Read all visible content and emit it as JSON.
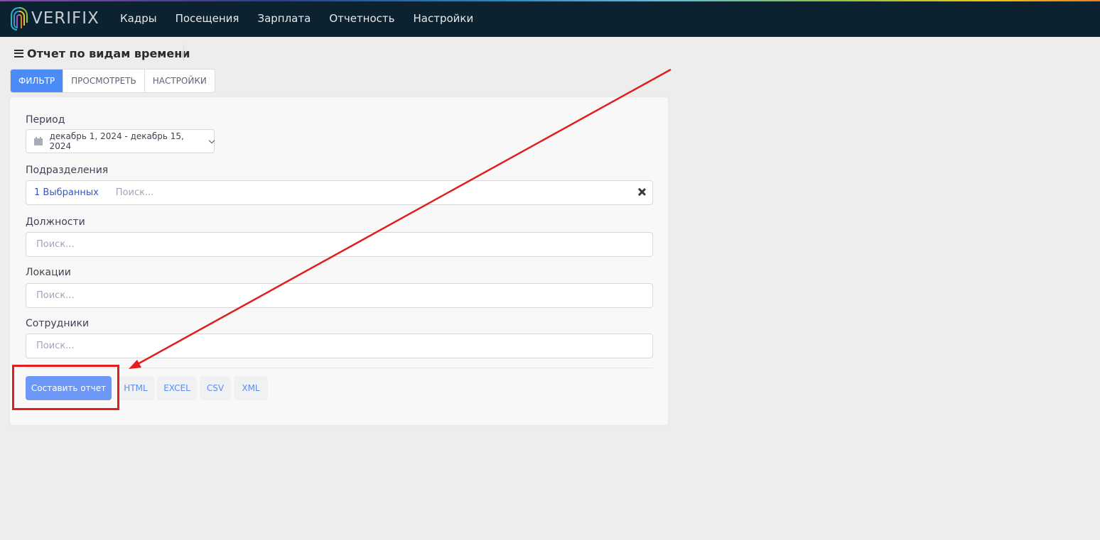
{
  "app": {
    "logo_text": "VERIFIX"
  },
  "nav": {
    "items": [
      {
        "label": "Кадры"
      },
      {
        "label": "Посещения"
      },
      {
        "label": "Зарплата"
      },
      {
        "label": "Отчетность"
      },
      {
        "label": "Настройки"
      }
    ]
  },
  "page": {
    "title": "Отчет по видам времени"
  },
  "tabs": [
    {
      "label": "ФИЛЬТР",
      "active": true
    },
    {
      "label": "ПРОСМОТРЕТЬ",
      "active": false
    },
    {
      "label": "НАСТРОЙКИ",
      "active": false
    }
  ],
  "form": {
    "period": {
      "label": "Период",
      "value": "декабрь 1, 2024 - декабрь 15, 2024"
    },
    "divisions": {
      "label": "Подразделения",
      "selected": "1 Выбранных",
      "placeholder": "Поиск..."
    },
    "positions": {
      "label": "Должности",
      "placeholder": "Поиск..."
    },
    "locations": {
      "label": "Локации",
      "placeholder": "Поиск..."
    },
    "employees": {
      "label": "Сотрудники",
      "placeholder": "Поиск..."
    }
  },
  "actions": {
    "build_report": "Составить отчет",
    "exports": [
      "HTML",
      "EXCEL",
      "CSV",
      "XML"
    ]
  },
  "colors": {
    "topbar": "#0d2230",
    "accent": "#4b8bf5",
    "annotation": "#e31c1c"
  }
}
